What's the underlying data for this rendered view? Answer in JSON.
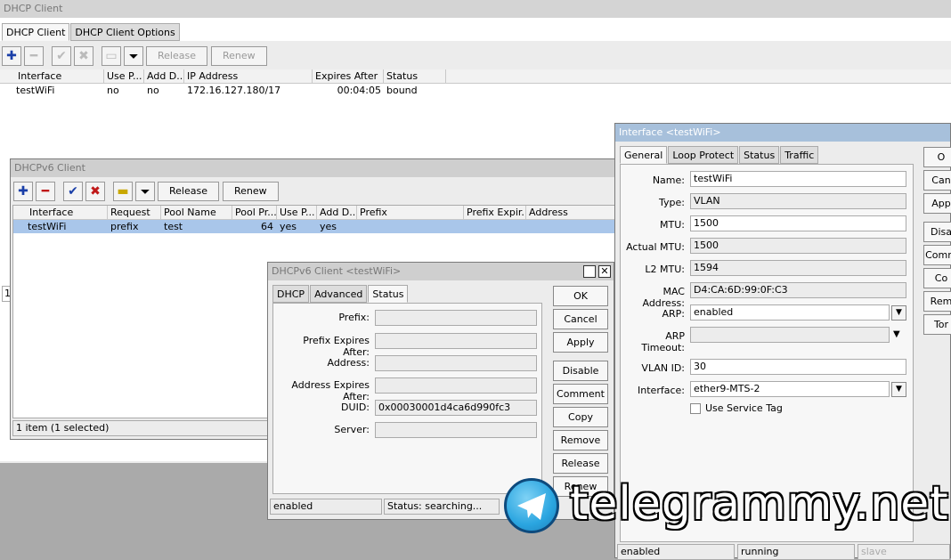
{
  "dhcp_client_window": {
    "title": "DHCP Client",
    "tabs": [
      "DHCP Client",
      "DHCP Client Options"
    ],
    "buttons": {
      "release": "Release",
      "renew": "Renew"
    },
    "columns": [
      "Interface",
      "Use P...",
      "Add D...",
      "IP Address",
      "Expires After",
      "Status"
    ],
    "rows": [
      {
        "interface": "testWiFi",
        "use_peer": "no",
        "add_default": "no",
        "ip": "172.16.127.180/17",
        "expires": "00:04:05",
        "status": "bound"
      }
    ]
  },
  "dhcpv6_window": {
    "title": "DHCPv6 Client",
    "buttons": {
      "release": "Release",
      "renew": "Renew"
    },
    "columns": [
      "Interface",
      "Request",
      "Pool Name",
      "Pool Pr...",
      "Use P...",
      "Add D...",
      "Prefix",
      "Prefix Expir...",
      "Address"
    ],
    "rows": [
      {
        "interface": "testWiFi",
        "request": "prefix",
        "pool": "test",
        "pool_prefix": "64",
        "use_peer": "yes",
        "add_default": "yes",
        "prefix": "",
        "prefix_exp": "",
        "address": ""
      }
    ],
    "status": "1 item (1 selected)",
    "left_marker": "1"
  },
  "dhcpv6_dialog": {
    "title": "DHCPv6 Client <testWiFi>",
    "tabs": [
      "DHCP",
      "Advanced",
      "Status"
    ],
    "fields": {
      "prefix_label": "Prefix:",
      "prefix_value": "",
      "prefix_expires_label": "Prefix Expires After:",
      "prefix_expires_value": "",
      "address_label": "Address:",
      "address_value": "",
      "address_expires_label": "Address Expires After:",
      "address_expires_value": "",
      "duid_label": "DUID:",
      "duid_value": "0x00030001d4ca6d990fc3",
      "server_label": "Server:",
      "server_value": ""
    },
    "buttons": [
      "OK",
      "Cancel",
      "Apply",
      "Disable",
      "Comment",
      "Copy",
      "Remove",
      "Release",
      "Renew"
    ],
    "status_left": "enabled",
    "status_right": "Status: searching..."
  },
  "interface_dialog": {
    "title": "Interface <testWiFi>",
    "tabs": [
      "General",
      "Loop Protect",
      "Status",
      "Traffic"
    ],
    "fields": {
      "name_label": "Name:",
      "name_value": "testWiFi",
      "type_label": "Type:",
      "type_value": "VLAN",
      "mtu_label": "MTU:",
      "mtu_value": "1500",
      "actual_mtu_label": "Actual MTU:",
      "actual_mtu_value": "1500",
      "l2mtu_label": "L2 MTU:",
      "l2mtu_value": "1594",
      "mac_label": "MAC Address:",
      "mac_value": "D4:CA:6D:99:0F:C3",
      "arp_label": "ARP:",
      "arp_value": "enabled",
      "arp_timeout_label": "ARP Timeout:",
      "arp_timeout_value": "",
      "vlan_label": "VLAN ID:",
      "vlan_value": "30",
      "iface_label": "Interface:",
      "iface_value": "ether9-MTS-2",
      "service_tag_label": "Use Service Tag"
    },
    "buttons": [
      "O",
      "Can",
      "App",
      "Disa",
      "Comm",
      "Co",
      "Rem",
      "Tor"
    ],
    "status": [
      "enabled",
      "running",
      "slave"
    ]
  },
  "watermark": "telegrammy.net"
}
